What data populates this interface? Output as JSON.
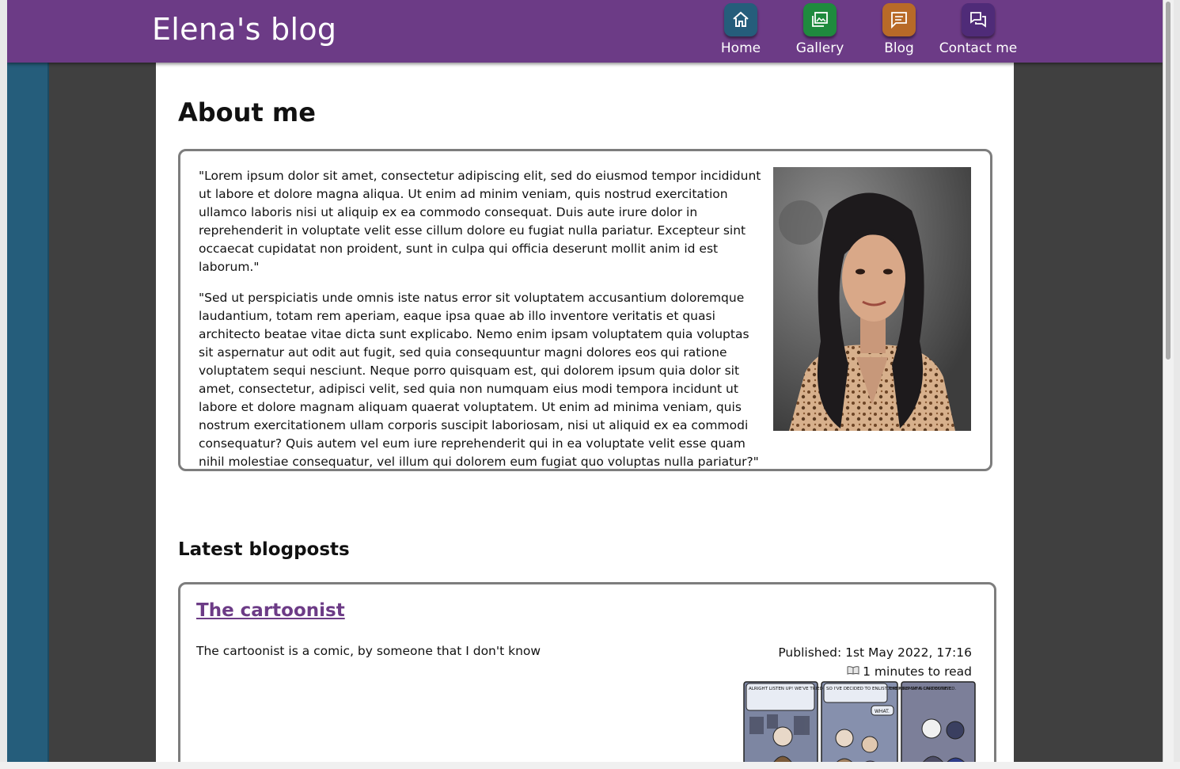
{
  "site": {
    "title": "Elena's blog"
  },
  "nav": [
    {
      "label": "Home",
      "icon": "home-icon",
      "color": "#255d7b"
    },
    {
      "label": "Gallery",
      "icon": "gallery-icon",
      "color": "#1f8a3e"
    },
    {
      "label": "Blog",
      "icon": "blog-icon",
      "color": "#b86a28"
    },
    {
      "label": "Contact me",
      "icon": "contact-icon",
      "color": "#4f2b78"
    }
  ],
  "about": {
    "heading": "About me",
    "paragraphs": [
      "\"Lorem ipsum dolor sit amet, consectetur adipiscing elit, sed do eiusmod tempor incididunt ut labore et dolore magna aliqua. Ut enim ad minim veniam, quis nostrud exercitation ullamco laboris nisi ut aliquip ex ea commodo consequat. Duis aute irure dolor in reprehenderit in voluptate velit esse cillum dolore eu fugiat nulla pariatur. Excepteur sint occaecat cupidatat non proident, sunt in culpa qui officia deserunt mollit anim id est laborum.\"",
      "\"Sed ut perspiciatis unde omnis iste natus error sit voluptatem accusantium doloremque laudantium, totam rem aperiam, eaque ipsa quae ab illo inventore veritatis et quasi architecto beatae vitae dicta sunt explicabo. Nemo enim ipsam voluptatem quia voluptas sit aspernatur aut odit aut fugit, sed quia consequuntur magni dolores eos qui ratione voluptatem sequi nesciunt. Neque porro quisquam est, qui dolorem ipsum quia dolor sit amet, consectetur, adipisci velit, sed quia non numquam eius modi tempora incidunt ut labore et dolore magnam aliquam quaerat voluptatem. Ut enim ad minima veniam, quis nostrum exercitationem ullam corporis suscipit laboriosam, nisi ut aliquid ex ea commodi consequatur? Quis autem vel eum iure reprehenderit qui in ea voluptate velit esse quam nihil molestiae consequatur, vel illum qui dolorem eum fugiat quo voluptas nulla pariatur?\""
    ]
  },
  "latest": {
    "heading": "Latest blogposts",
    "posts": [
      {
        "title": "The cartoonist",
        "excerpt": "The cartoonist is a comic, by someone that I don't know",
        "published": "Published: 1st May 2022, 17:16",
        "read_time": "1 minutes to read",
        "comic_text": [
          "ALRIGHT LISTEN UP! WE'VE TRIED EVERYTHING, BUT THIS MURDERER REMAINS UNIDENTIFIED.",
          "SO I'VE DECIDED TO ENLIST THE HELP OF A CARTOONIST.",
          "WHAT."
        ]
      }
    ]
  },
  "colors": {
    "header": "#6c3b86",
    "link": "#6c3b86",
    "side_strip": "#255d7b",
    "page_bg": "#404040"
  }
}
